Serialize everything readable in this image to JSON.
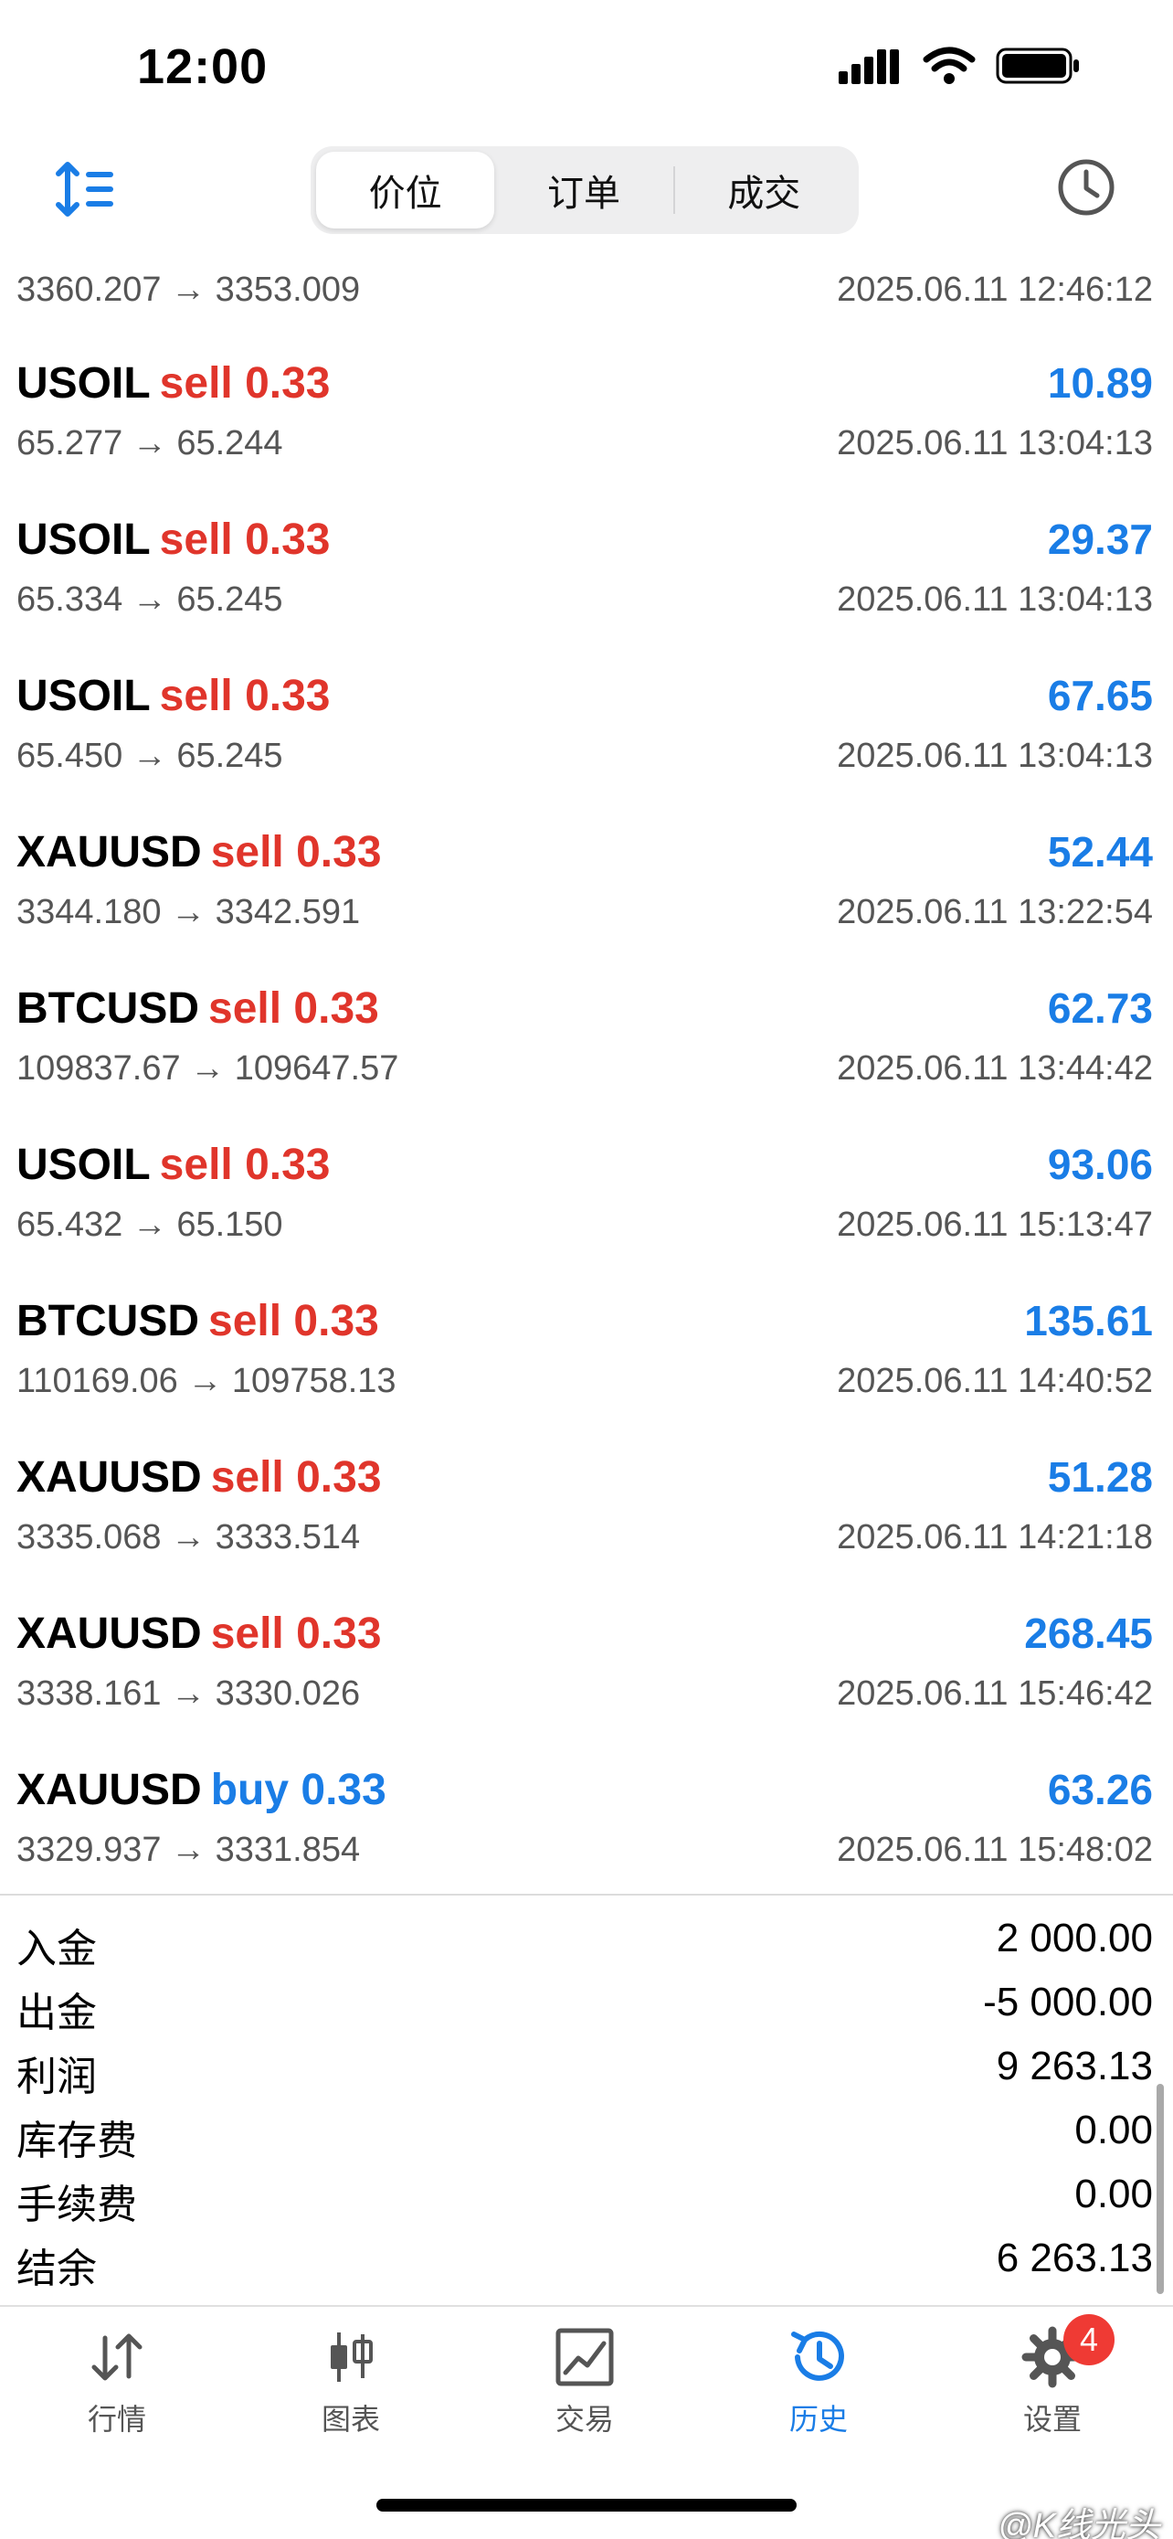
{
  "status_bar": {
    "time": "12:00"
  },
  "toolbar": {
    "segments": [
      {
        "label": "价位",
        "active": true
      },
      {
        "label": "订单",
        "active": false
      },
      {
        "label": "成交",
        "active": false
      }
    ]
  },
  "partial_first": {
    "prices": "3360.207 → 3353.009",
    "time": "2025.06.11 12:46:12"
  },
  "deals": [
    {
      "symbol": "USOIL",
      "side": "sell",
      "volume": "0.33",
      "prices": "65.277 → 65.244",
      "time": "2025.06.11 13:04:13",
      "profit": "10.89"
    },
    {
      "symbol": "USOIL",
      "side": "sell",
      "volume": "0.33",
      "prices": "65.334 → 65.245",
      "time": "2025.06.11 13:04:13",
      "profit": "29.37"
    },
    {
      "symbol": "USOIL",
      "side": "sell",
      "volume": "0.33",
      "prices": "65.450 → 65.245",
      "time": "2025.06.11 13:04:13",
      "profit": "67.65"
    },
    {
      "symbol": "XAUUSD",
      "side": "sell",
      "volume": "0.33",
      "prices": "3344.180 → 3342.591",
      "time": "2025.06.11 13:22:54",
      "profit": "52.44"
    },
    {
      "symbol": "BTCUSD",
      "side": "sell",
      "volume": "0.33",
      "prices": "109837.67 → 109647.57",
      "time": "2025.06.11 13:44:42",
      "profit": "62.73"
    },
    {
      "symbol": "USOIL",
      "side": "sell",
      "volume": "0.33",
      "prices": "65.432 → 65.150",
      "time": "2025.06.11 15:13:47",
      "profit": "93.06"
    },
    {
      "symbol": "BTCUSD",
      "side": "sell",
      "volume": "0.33",
      "prices": "110169.06 → 109758.13",
      "time": "2025.06.11 14:40:52",
      "profit": "135.61"
    },
    {
      "symbol": "XAUUSD",
      "side": "sell",
      "volume": "0.33",
      "prices": "3335.068 → 3333.514",
      "time": "2025.06.11 14:21:18",
      "profit": "51.28"
    },
    {
      "symbol": "XAUUSD",
      "side": "sell",
      "volume": "0.33",
      "prices": "3338.161 → 3330.026",
      "time": "2025.06.11 15:46:42",
      "profit": "268.45"
    },
    {
      "symbol": "XAUUSD",
      "side": "buy",
      "volume": "0.33",
      "prices": "3329.937 → 3331.854",
      "time": "2025.06.11 15:48:02",
      "profit": "63.26"
    }
  ],
  "summary": [
    {
      "label": "入金",
      "value": "2 000.00"
    },
    {
      "label": "出金",
      "value": "-5 000.00"
    },
    {
      "label": "利润",
      "value": "9 263.13"
    },
    {
      "label": "库存费",
      "value": "0.00"
    },
    {
      "label": "手续费",
      "value": "0.00"
    },
    {
      "label": "结余",
      "value": "6 263.13"
    }
  ],
  "tabbar": {
    "tabs": [
      {
        "label": "行情",
        "icon": "arrows-updown-icon"
      },
      {
        "label": "图表",
        "icon": "candlestick-icon"
      },
      {
        "label": "交易",
        "icon": "trade-chart-icon"
      },
      {
        "label": "历史",
        "icon": "history-clock-icon",
        "active": true
      },
      {
        "label": "设置",
        "icon": "gear-icon",
        "badge": "4"
      }
    ]
  },
  "watermark": "@K线光头",
  "colors": {
    "accent": "#1a7de6",
    "sell": "#e0352b",
    "badge": "#ef3a34"
  }
}
